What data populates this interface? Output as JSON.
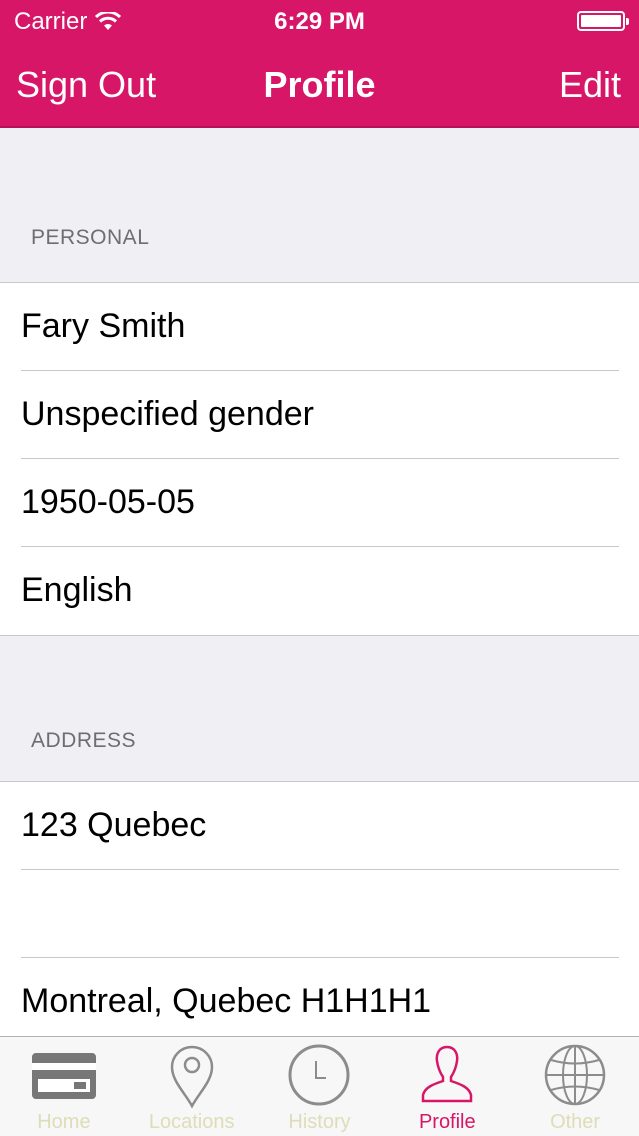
{
  "status_bar": {
    "carrier": "Carrier",
    "time": "6:29 PM"
  },
  "nav": {
    "left_button": "Sign Out",
    "title": "Profile",
    "right_button": "Edit"
  },
  "sections": [
    {
      "header": "PERSONAL",
      "rows": [
        "Fary Smith",
        "Unspecified gender",
        "1950-05-05",
        "English"
      ]
    },
    {
      "header": "ADDRESS",
      "rows": [
        "123 Quebec",
        "",
        "Montreal, Quebec H1H1H1"
      ]
    }
  ],
  "tabs": [
    {
      "label": "Home",
      "icon": "card-icon",
      "active": false
    },
    {
      "label": "Locations",
      "icon": "location-pin-icon",
      "active": false
    },
    {
      "label": "History",
      "icon": "clock-icon",
      "active": false
    },
    {
      "label": "Profile",
      "icon": "person-icon",
      "active": true
    },
    {
      "label": "Other",
      "icon": "globe-icon",
      "active": false
    }
  ],
  "colors": {
    "accent": "#d81667",
    "inactive_tab": "#ddddb8",
    "background": "#efeff4"
  }
}
